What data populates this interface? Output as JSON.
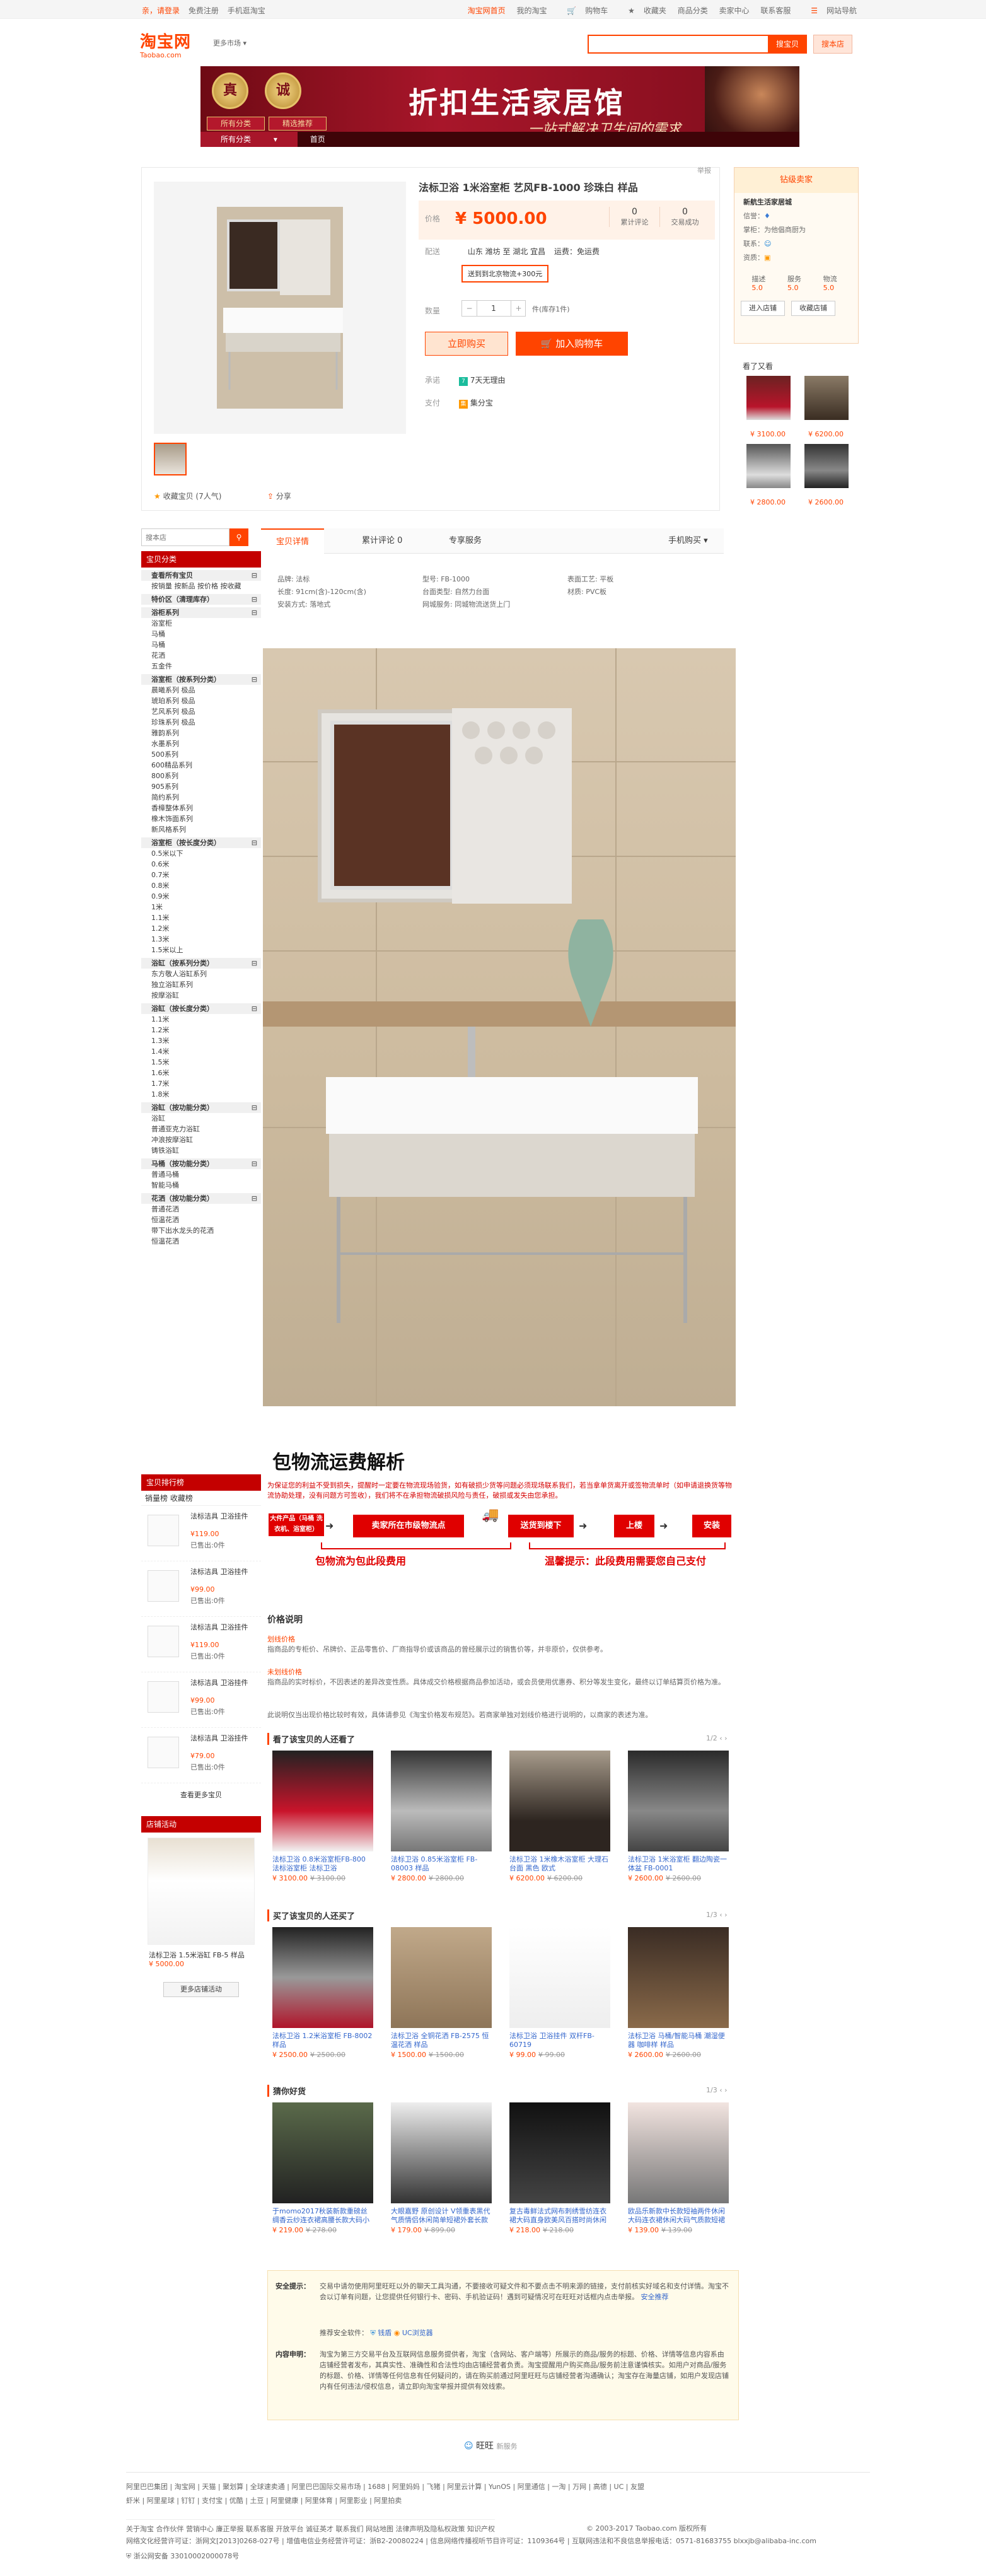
{
  "sitenav": {
    "left": [
      "亲，请登录",
      "免费注册",
      "手机逛淘宝"
    ],
    "right": [
      "淘宝网首页",
      "我的淘宝",
      "购物车",
      "收藏夹",
      "商品分类",
      "卖家中心",
      "联系客服",
      "网站导航"
    ]
  },
  "header": {
    "logo_cn": "淘宝网",
    "logo_en": "Taobao.com",
    "shop_select": "更多市场",
    "search_btn_all": "搜宝贝",
    "search_btn_shop": "搜本店",
    "search_placeholder": ""
  },
  "banner": {
    "title": "折扣生活家居馆",
    "subtitle": "一站式解决卫生间的需求",
    "seal1": "真",
    "seal2": "诚",
    "label1": "所有分类",
    "label2": "精选推荐",
    "nav": [
      "所有分类",
      "首页"
    ]
  },
  "product": {
    "title": "法标卫浴 1米浴室柜 艺风FB-1000 珍珠白 样品",
    "report": "举报",
    "price_label": "价格",
    "price": "¥ 5000.00",
    "stat_reviews_num": "0",
    "stat_reviews_label": "累计评论",
    "stat_sales_num": "0",
    "stat_sales_label": "交易成功",
    "shipping_label": "配送",
    "shipping_value": "山东 潍坊 至  湖北 宜昌",
    "shipping_extra": "运费：免运费",
    "shipping_notice": "送到到北京物流+300元",
    "qty_label": "数量",
    "qty_value": "1",
    "stock": "件(库存1件)",
    "buy_now": "立即购买",
    "add_cart": "加入购物车",
    "promise_label": "承诺",
    "promise_value": "7天无理由",
    "pay_label": "支付",
    "pay_value": "集分宝",
    "collect": "收藏宝贝 (7人气)",
    "share": "分享"
  },
  "seller": {
    "header": "钻级卖家",
    "shop": "新航生活家居城",
    "cert": "信誉：",
    "addr": "掌柜：为他倡商厨为",
    "contact": "联系：",
    "qual": "资质：",
    "desc_label": "描述",
    "serve_label": "服务",
    "ship_label": "物流",
    "desc_score": "5.0",
    "serve_score": "5.0",
    "ship_score": "5.0",
    "enter_btn": "进入店铺",
    "fav_btn": "收藏店铺",
    "recommend": "看了又看",
    "rec_prices": [
      "¥ 3100.00",
      "¥ 6200.00",
      "¥ 2800.00",
      "¥ 2600.00"
    ]
  },
  "left": {
    "search_placeholder": "搜本店",
    "cat_title": "宝贝分类",
    "categories": [
      {
        "t": "查看所有宝贝",
        "g": true
      },
      {
        "t": "按销量 按新品 按价格 按收藏",
        "g": false
      },
      {
        "t": "特价区（清理库存）",
        "g": true
      },
      {
        "t": "浴柜系列",
        "g": true
      },
      {
        "t": "浴室柜",
        "g": false
      },
      {
        "t": "马桶",
        "g": false
      },
      {
        "t": "马桶",
        "g": false
      },
      {
        "t": "花洒",
        "g": false
      },
      {
        "t": "五金件",
        "g": false
      },
      {
        "t": "浴室柜（按系列分类）",
        "g": true
      },
      {
        "t": "晨曦系列 极品",
        "g": false
      },
      {
        "t": "琥珀系列 极品",
        "g": false
      },
      {
        "t": "艺风系列 极品",
        "g": false
      },
      {
        "t": "珍珠系列 极品",
        "g": false
      },
      {
        "t": "雅韵系列",
        "g": false
      },
      {
        "t": "水墨系列",
        "g": false
      },
      {
        "t": "500系列",
        "g": false
      },
      {
        "t": "600精品系列",
        "g": false
      },
      {
        "t": "800系列",
        "g": false
      },
      {
        "t": "905系列",
        "g": false
      },
      {
        "t": "简约系列",
        "g": false
      },
      {
        "t": "香樟整体系列",
        "g": false
      },
      {
        "t": "橡木饰面系列",
        "g": false
      },
      {
        "t": "新风格系列",
        "g": false
      },
      {
        "t": "浴室柜（按长度分类）",
        "g": true
      },
      {
        "t": "0.5米以下",
        "g": false
      },
      {
        "t": "0.6米",
        "g": false
      },
      {
        "t": "0.7米",
        "g": false
      },
      {
        "t": "0.8米",
        "g": false
      },
      {
        "t": "0.9米",
        "g": false
      },
      {
        "t": "1米",
        "g": false
      },
      {
        "t": "1.1米",
        "g": false
      },
      {
        "t": "1.2米",
        "g": false
      },
      {
        "t": "1.3米",
        "g": false
      },
      {
        "t": "1.5米以上",
        "g": false
      },
      {
        "t": "浴缸（按系列分类）",
        "g": true
      },
      {
        "t": "东方敬人浴缸系列",
        "g": false
      },
      {
        "t": "独立浴缸系列",
        "g": false
      },
      {
        "t": "按摩浴缸",
        "g": false
      },
      {
        "t": "浴缸（按长度分类）",
        "g": true
      },
      {
        "t": "1.1米",
        "g": false
      },
      {
        "t": "1.2米",
        "g": false
      },
      {
        "t": "1.3米",
        "g": false
      },
      {
        "t": "1.4米",
        "g": false
      },
      {
        "t": "1.5米",
        "g": false
      },
      {
        "t": "1.6米",
        "g": false
      },
      {
        "t": "1.7米",
        "g": false
      },
      {
        "t": "1.8米",
        "g": false
      },
      {
        "t": "浴缸（按功能分类）",
        "g": true
      },
      {
        "t": "浴缸",
        "g": false
      },
      {
        "t": "普通亚克力浴缸",
        "g": false
      },
      {
        "t": "冲浪按摩浴缸",
        "g": false
      },
      {
        "t": "铸铁浴缸",
        "g": false
      },
      {
        "t": "马桶（按功能分类）",
        "g": true
      },
      {
        "t": "普通马桶",
        "g": false
      },
      {
        "t": "智能马桶",
        "g": false
      },
      {
        "t": "花洒（按功能分类）",
        "g": true
      },
      {
        "t": "普通花洒",
        "g": false
      },
      {
        "t": "恒温花洒",
        "g": false
      },
      {
        "t": "带下出水龙头的花洒",
        "g": false
      },
      {
        "t": "恒温花洒",
        "g": false
      }
    ],
    "rank_title": "宝贝排行榜",
    "rank_tabs": "销量榜  收藏榜",
    "rank_items": [
      {
        "t": "法标洁具 卫浴挂件",
        "p": "¥119.00",
        "s": "已售出:0件"
      },
      {
        "t": "法标洁具 卫浴挂件",
        "p": "¥99.00",
        "s": "已售出:0件"
      },
      {
        "t": "法标洁具 卫浴挂件",
        "p": "¥119.00",
        "s": "已售出:0件"
      },
      {
        "t": "法标洁具 卫浴挂件",
        "p": "¥99.00",
        "s": "已售出:0件"
      },
      {
        "t": "法标洁具 卫浴挂件",
        "p": "¥79.00",
        "s": "已售出:0件"
      }
    ],
    "rank_more": "查看更多宝贝",
    "activity_title": "店铺活动",
    "activity_item": "法标卫浴 1.5米浴缸 FB-5 样品",
    "activity_price": "¥ 5000.00",
    "activity_more": "更多店铺活动"
  },
  "tabs": [
    "宝贝详情",
    "累计评论 0",
    "专享服务",
    "手机购买"
  ],
  "attrs": [
    "品牌: 法标",
    "型号: FB-1000",
    "表面工艺: 平板",
    "长度: 91cm(含)-120cm(含)",
    "台面类型: 自然力台面",
    "材质: PVC板",
    "安装方式: 落地式",
    "网城服务: 同城物流送货上门"
  ],
  "logistics": {
    "title": "包物流运费解析",
    "para": "为保证您的利益不受到损失，提醒时一定要在物流现场验货，如有破损少货等问题必须现场联系我们，若当拿单货离开或签物流单时（如申请退换货等物流协助处理，没有问题方可签收），我们将不在承担物流破损风险与责任，破损或发失由您承担。",
    "steps": [
      "卖家所在市级物流点",
      "送货到楼下",
      "上楼",
      "安装"
    ],
    "left_step": "大件产品（马桶 洗衣机、浴室柜）",
    "red1": "包物流为包此段费用",
    "red2": "温馨提示：此段费用需要您自己支付"
  },
  "priceinfo": {
    "title": "价格说明",
    "l1": "划线价格",
    "t1": "指商品的专柜价、吊牌价、正品零售价、厂商指导价或该商品的曾经展示过的销售价等，并非原价，仅供参考。",
    "l2": "未划线价格",
    "t2": "指商品的实时标价，不因表述的差异改变性质。具体成交价格根据商品参加活动，或会员使用优惠券、积分等发生变化，最终以订单结算页价格为准。",
    "t3": "此说明仅当出现价格比较时有效，具体请参见《淘宝价格发布规范》。若商家单独对划线价格进行说明的，以商家的表述为准。"
  },
  "sec_viewed": {
    "title": "看了该宝贝的人还看了",
    "pager": "1/2",
    "items": [
      {
        "n": "法标卫浴 0.8米浴室柜FB-800 法标浴室柜 法标卫浴",
        "p": "¥ 3100.00",
        "o": "¥ 3100.00"
      },
      {
        "n": "法标卫浴 0.85米浴室柜 FB-08003 样品",
        "p": "¥ 2800.00",
        "o": "¥ 2800.00"
      },
      {
        "n": "法标卫浴 1米橡木浴室柜 大理石台面 黑色 欧式",
        "p": "¥ 6200.00",
        "o": "¥ 6200.00"
      },
      {
        "n": "法标卫浴 1米浴室柜 翻边陶瓷一体盆 FB-0001",
        "p": "¥ 2600.00",
        "o": "¥ 2600.00"
      }
    ]
  },
  "sec_bought": {
    "title": "买了该宝贝的人还买了",
    "pager": "1/3",
    "items": [
      {
        "n": "法标卫浴 1.2米浴室柜 FB-8002 样品",
        "p": "¥ 2500.00",
        "o": "¥ 2500.00"
      },
      {
        "n": "法标卫浴 全铜花洒 FB-2575 恒温花洒 样品",
        "p": "¥ 1500.00",
        "o": "¥ 1500.00"
      },
      {
        "n": "法标卫浴 卫浴挂件 双杆FB-60719",
        "p": "¥ 99.00",
        "o": "¥ 99.00"
      },
      {
        "n": "法标卫浴 马桶/智能马桶 潮湿便器 咖啡样 样品",
        "p": "¥ 2600.00",
        "o": "¥ 2600.00"
      }
    ]
  },
  "sec_hot": {
    "title": "猜你好货",
    "pager": "1/3",
    "items": [
      {
        "n": "于momo2017秋装新款重磅丝绸香云纱连衣裙高腰长款大码小摆裙",
        "p": "¥ 219.00",
        "o": "¥ 278.00"
      },
      {
        "n": "大眼嘉野 原创设计 V领重表黑代气质情侣休闲简单短裙外套长款",
        "p": "¥ 179.00",
        "o": "¥ 899.00"
      },
      {
        "n": "复古毒鲜法式网布刺绣雪纺连衣裙大码直身欧美风百搭时尚休闲",
        "p": "¥ 218.00",
        "o": "¥ 218.00"
      },
      {
        "n": "欧品乐新款中长款短袖两件休闲大码连衣裙休闲大码气质款短裙",
        "p": "¥ 139.00",
        "o": "¥ 139.00"
      }
    ]
  },
  "notice": {
    "safe_label": "安全提示：",
    "safe_text": "交易中请勿使用阿里旺旺以外的聊天工具沟通，不要接收可疑文件和不要点击不明来源的链接，支付前核实好域名和支付详情。淘宝不会以订单有问题，让您提供任何银行卡、密码、手机验证码！遇到可疑情况可在旺旺对话框内点击举报。",
    "safe_link": "安全推荐",
    "safe_soft": "推荐安全软件：",
    "safe_s1": "钱盾",
    "safe_s2": "UC浏览器",
    "desc_label": "内容申明：",
    "desc_text": "淘宝为第三方交易平台及互联网信息服务提供者，淘宝（含网站、客户端等）所展示的商品/服务的标题、价格、详情等信息内容系由店铺经营者发布，其真实性、准确性和合法性均由店铺经营者负责。淘宝提醒用户购买商品/服务前注意谨慎核实。如用户对商品/服务的标题、价格、详情等任何信息有任何疑问的，请在购买前通过阿里旺旺与店铺经营者沟通确认；淘宝存在海量店铺，如用户发现店铺内有任何违法/侵权信息，请立即向淘宝举报并提供有效线索。"
  },
  "footer": {
    "wangwang": "旺旺",
    "wangwang_sub": "新服务",
    "links1": "阿里巴巴集团 | 淘宝网 | 天猫 | 聚划算 | 全球速卖通 | 阿里巴巴国际交易市场 | 1688 | 阿里妈妈 | 飞猪 | 阿里云计算 | YunOS | 阿里通信 | 一淘 | 万网 | 高德 | UC | 友盟",
    "links2": "虾米 | 阿里星球 | 钉钉 | 支付宝 | 优酷 | 土豆 | 阿里健康 | 阿里体育 | 阿里影业 | 阿里拍卖",
    "links3": "关于淘宝  合作伙伴  营销中心  廉正举报  联系客服  开放平台  诚征英才  联系我们  网站地图  法律声明及隐私权政策  知识产权",
    "copyright": "© 2003-2017 Taobao.com 版权所有",
    "icp": "网络文化经营许可证：浙网文[2013]0268-027号 | 增值电信业务经营许可证：浙B2-20080224 | 信息网络传播视听节目许可证：1109364号 | 互联网违法和不良信息举报电话：0571-81683755 blxxjb@alibaba-inc.com",
    "police": "浙公网安备 33010002000078号"
  }
}
